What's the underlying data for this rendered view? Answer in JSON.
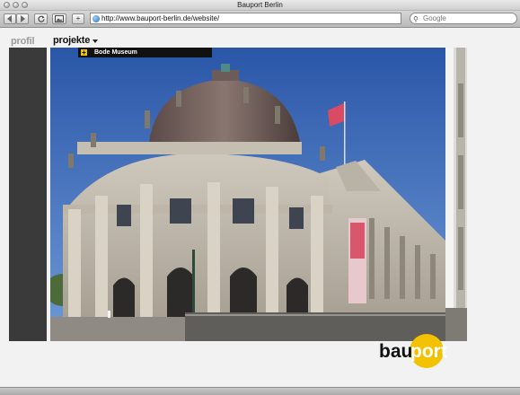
{
  "window": {
    "title": "Bauport Berlin"
  },
  "toolbar": {
    "url": "http://www.bauport-berlin.de/website/",
    "search_placeholder": "Google",
    "add_label": "+"
  },
  "nav": {
    "items": [
      {
        "label": "profil",
        "active": false
      },
      {
        "label": "projekte",
        "active": true
      }
    ]
  },
  "submenu": {
    "items": [
      {
        "label": "Bode Museum"
      }
    ]
  },
  "logo": {
    "text_part1": "bau",
    "text_part2": "port"
  },
  "colors": {
    "accent": "#f2c200",
    "dark_strip": "#3a3a3a",
    "sky": "#2f5fb0"
  }
}
